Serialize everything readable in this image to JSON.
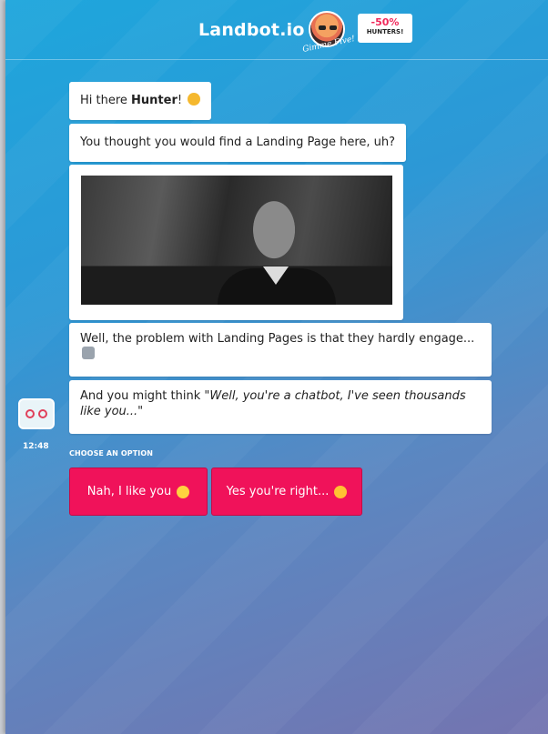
{
  "header": {
    "brand": "Landbot.io",
    "signature": "Gimme Five!",
    "promo_pct": "-50%",
    "promo_label": "HUNTERS!"
  },
  "messages": {
    "greeting_prefix": "Hi there ",
    "greeting_name": "Hunter",
    "greeting_suffix": "!",
    "m2": "You thought you would find a Landing Page here, uh?",
    "m4": "Well, the problem with Landing Pages is that they hardly engage...",
    "m5_prefix": "And you might think ",
    "m5_quote": "\"Well, you're a chatbot, I've seen thousands like you...\""
  },
  "bot": {
    "time": "12:48"
  },
  "options": {
    "heading": "CHOOSE AN OPTION",
    "o1": "Nah, I like you",
    "o2": "Yes you're right..."
  },
  "icons": {
    "cat": "smiling-cat-emoji",
    "robot": "robot-emoji",
    "smile": "smiling-face-emoji",
    "unamused": "unamused-face-emoji"
  },
  "colors": {
    "accent": "#f0125a",
    "gradient_top": "#1ea6dc",
    "gradient_bottom": "#7474b0"
  }
}
